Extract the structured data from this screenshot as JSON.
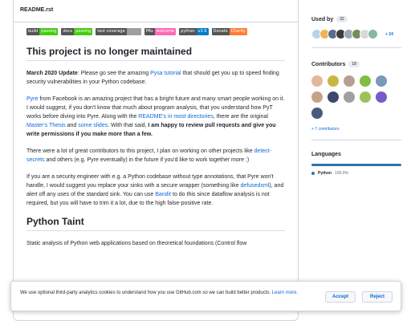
{
  "readme": {
    "filename": "README.rst",
    "badges": [
      {
        "label": "build",
        "value": "passing",
        "color": "#4c1"
      },
      {
        "label": "docs",
        "value": "passing",
        "color": "#4c1"
      },
      {
        "label": "test coverage",
        "value": "",
        "color": "#9f9f9f"
      },
      {
        "label": "PRs",
        "value": "welcome",
        "color": "#ff69b4"
      },
      {
        "label": "python",
        "value": "v3.6",
        "color": "#007ec6"
      },
      {
        "label": "Donate",
        "value": "Charity",
        "color": "#fe7d37"
      }
    ],
    "heading1": "This project is no longer maintained",
    "p1": {
      "strong": "March 2020 Update",
      "t1": ": Please go see the amazing ",
      "link1": "Pysa tutorial",
      "t2": " that should get you up to speed finding security vulnerabilities in your Python codebase."
    },
    "p2": {
      "link1": "Pyre",
      "t1": " from Facebook is an amazing project that has a bright future and many smart people working on it. I would suggest, if you don't know that much about program analysis, that you understand how PyT works before diving into Pyre. Along with the ",
      "link2": "README's in most directories",
      "t2": ", there are the original ",
      "link3": "Master's Thesis",
      "t3": " and ",
      "link4": "some slides",
      "t4": ". With that said, ",
      "strong": "I am happy to review pull requests and give you write permissions if you make more than a few."
    },
    "p3": {
      "t1": "There were a lot of great contributors to this project, I plan on working on other projects like ",
      "link1": "detect-secrets",
      "t2": " and others (e.g. Pyre eventually) in the future if you'd like to work together more :)"
    },
    "p4": {
      "t1": "If you are a security engineer with e.g. a Python codebase without type annotations, that Pyre won't handle, I would suggest you replace your sinks with a secure wrapper (something like ",
      "link1": "defusedxml",
      "t2": "), and alert off any uses of the standard sink. You can use ",
      "link2": "Bandit",
      "t3": " to do this since dataflow analysis is not required, but you will have to trim it a lot, due to the high false-positive rate."
    },
    "heading2": "Python Taint",
    "p5": "Static analysis of Python web applications based on theoretical foundations (Control flow"
  },
  "sidebar": {
    "used_by": {
      "title": "Used by",
      "count": "32",
      "more": "+ 24",
      "avatars": [
        "#b9d3e8",
        "#f0b35a",
        "#5a6b8c",
        "#3d3d3d",
        "#9aa7b5",
        "#6f8f5a",
        "#d9d9d9",
        "#88b8a0"
      ]
    },
    "contributors": {
      "title": "Contributors",
      "count": "18",
      "more": "+ 7 contributors",
      "avatars": [
        "#e3b89a",
        "#c9b640",
        "#b7a091",
        "#7fbf3f",
        "#7a9ab8",
        "#c4a38a",
        "#3b4a6b",
        "#a0a0a0",
        "#9bc35a",
        "#7a5ac8",
        "#4a5a7a"
      ]
    },
    "languages": {
      "title": "Languages",
      "name": "Python",
      "percent": "100.0%",
      "color": "#3572A5"
    }
  },
  "cookie_banner": {
    "text": "We use optional third-party analytics cookies to understand how you use GitHub.com so we can build better products.",
    "learn_more": "Learn more.",
    "accept": "Accept",
    "reject": "Reject"
  }
}
